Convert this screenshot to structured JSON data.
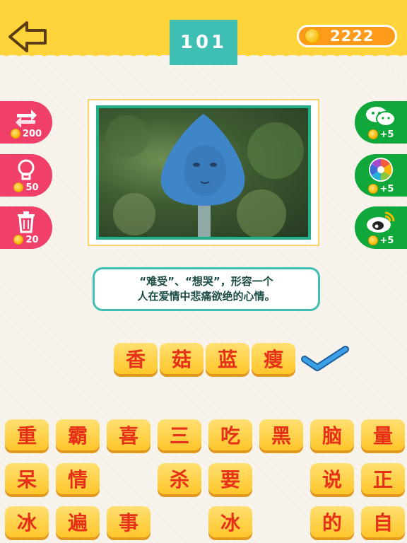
{
  "header": {
    "level": "101",
    "coins": "2222"
  },
  "left_tools": [
    {
      "name": "refresh",
      "cost": "200"
    },
    {
      "name": "hint",
      "cost": "50"
    },
    {
      "name": "delete",
      "cost": "20"
    }
  ],
  "right_shares": [
    {
      "name": "wechat",
      "reward": "+5"
    },
    {
      "name": "moments",
      "reward": "+5"
    },
    {
      "name": "weibo",
      "reward": "+5"
    }
  ],
  "clue": {
    "line1": "“难受”、“想哭”，形容一个",
    "line2": "人在爱情中悲痛欲绝的心情。"
  },
  "answer": [
    "香",
    "菇",
    "蓝",
    "瘦"
  ],
  "choices": {
    "row1": [
      "重",
      "霸",
      "喜",
      "三",
      "吃",
      "黑",
      "脑",
      "量"
    ],
    "row2": [
      "呆",
      "情",
      "",
      "杀",
      "要",
      "",
      "说",
      "正"
    ],
    "row3": [
      "冰",
      "遍",
      "事",
      "",
      "冰",
      "",
      "的",
      "自"
    ]
  },
  "colors": {
    "header": "#ffd43a",
    "level_tab": "#3fbfb3",
    "coin_pill": "#ff9a1a",
    "tool_red": "#f0406a",
    "share_green": "#10a83a",
    "tile": "#ffd04a",
    "tile_text": "#e63018",
    "check": "#2f8fd8"
  },
  "icons": {
    "back": "arrow-left-icon",
    "refresh": "refresh-arrows-icon",
    "hint": "lightbulb-icon",
    "delete": "trash-can-icon",
    "wechat": "wechat-icon",
    "moments": "camera-shutter-icon",
    "weibo": "weibo-icon",
    "correct": "checkmark-icon"
  }
}
